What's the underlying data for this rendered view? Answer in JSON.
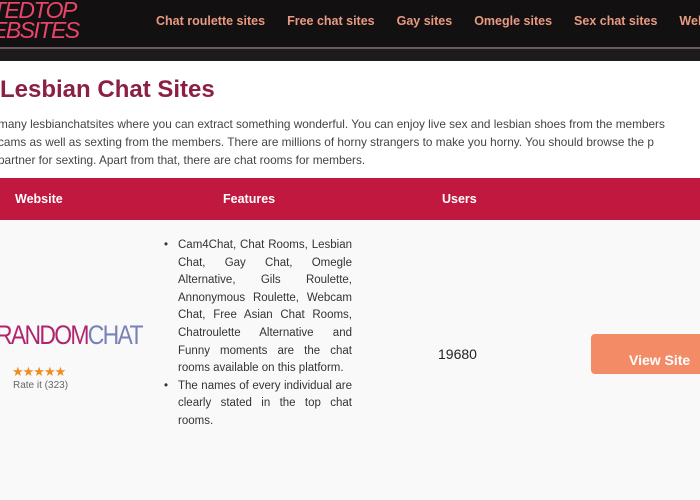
{
  "header": {
    "logo_line1": "TEDTOP",
    "logo_line2": "EBSITES",
    "nav": [
      "Chat roulette sites",
      "Free chat sites",
      "Gay sites",
      "Omegle sites",
      "Sex chat sites",
      "Webcam"
    ]
  },
  "page": {
    "title": "Lesbian Chat Sites",
    "intro": [
      "many lesbianchatsites where you can extract something wonderful. You can enjoy live sex and lesbian shoes from the members",
      " cams as well as sexting from the members. There are millions of horny strangers to make you horny. You should browse the p",
      " partner for sexting. Apart from that, there are chat rooms for members."
    ]
  },
  "table": {
    "headers": [
      "Website",
      "Features",
      "Users"
    ],
    "rows": [
      {
        "brand_part1": "RANDOM",
        "brand_part2": "CHAT",
        "stars": "★★★★★",
        "rating": 5,
        "rate_label": "Rate it (323)",
        "features": [
          "Cam4Chat, Chat Rooms, Lesbian Chat, Gay Chat, Omegle Alternative, Gils Roulette, Annonymous Roulette, Webcam Chat, Free Asian Chat Rooms, Chatroulette Alternative and Funny moments are the chat rooms available on this platform.",
          "The names of every individual are clearly stated in the top chat rooms."
        ],
        "users": "19680",
        "button": "View Site"
      }
    ]
  }
}
